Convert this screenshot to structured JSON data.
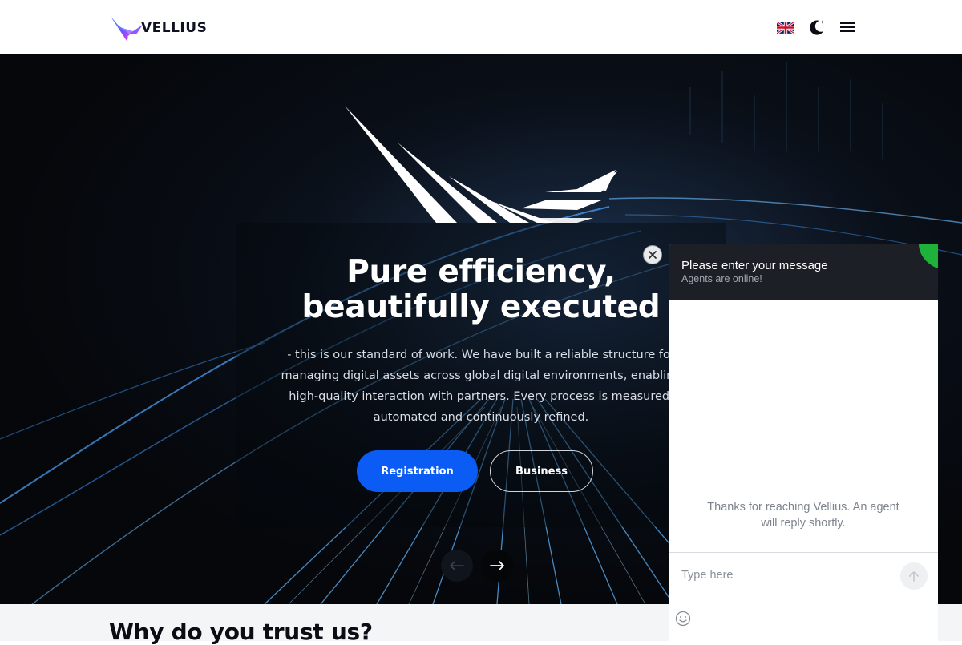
{
  "header": {
    "brand": "VELLIUS",
    "language_icon": "uk-flag-icon",
    "theme_icon": "moon-stars-icon",
    "menu_icon": "hamburger-menu-icon"
  },
  "hero": {
    "title_line1": "Pure efficiency,",
    "title_line2": "beautifully executed",
    "description": "- this is our standard of work. We have built a reliable structure for managing digital assets across global digital environments, enabling high-quality interaction with partners. Every process is measured, automated and continuously refined.",
    "registration_label": "Registration",
    "business_label": "Business",
    "prev_icon": "arrow-left-icon",
    "next_icon": "arrow-right-icon"
  },
  "trust": {
    "title": "Why do you trust us?"
  },
  "chat": {
    "title": "Please enter your message",
    "status": "Agents are online!",
    "message": "Thanks for reaching Vellius. An agent will reply shortly.",
    "input_placeholder": "Type here",
    "input_value": "",
    "send_icon": "arrow-up-icon",
    "emoji_icon": "smiley-icon",
    "close_icon": "close-icon"
  },
  "colors": {
    "accent_blue": "#0a5cf5",
    "online_green": "#1fb23a",
    "chat_header": "#1c1f25"
  }
}
